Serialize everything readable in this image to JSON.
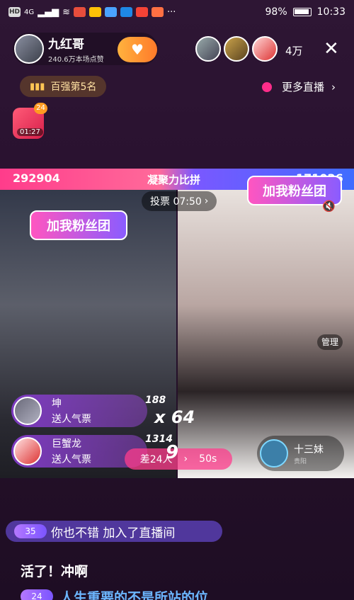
{
  "status": {
    "left_icons": [
      "HD",
      "4G",
      "signal-icon",
      "wifi-icon",
      "app-icon",
      "app-icon",
      "app-icon",
      "app-icon",
      "app-icon",
      "weibo-icon"
    ],
    "more": "···",
    "battery": "98%",
    "time": "10:33"
  },
  "host": {
    "name": "九红哥",
    "likes": "240.6万本场点赞",
    "follow_icon": "heart-plus-icon"
  },
  "viewers": {
    "count": "4万"
  },
  "rank": {
    "label": "百强第5名"
  },
  "more_live": {
    "label": "更多直播",
    "chevron": "›"
  },
  "gift_box": {
    "badge": "24",
    "timer": "01:27"
  },
  "pk": {
    "score_left": "292904",
    "title": "凝聚力比拼",
    "score_right": "171026",
    "vote": "投票 07:50",
    "vote_chevron": "›",
    "diff_label": "差24人",
    "diff_chevron": "›",
    "diff_time": "50s",
    "multiplier_overlay": "9"
  },
  "fan_badge": {
    "left": "加我粉丝团",
    "right": "加我粉丝团"
  },
  "manage_label": "管理",
  "gift_messages": [
    {
      "name": "坤",
      "action": "送人气票",
      "count": "188",
      "combo": "x 64"
    },
    {
      "name": "巨蟹龙",
      "action": "送人气票",
      "count": "1314",
      "combo": "x"
    }
  ],
  "opponent": {
    "name": "十三妹",
    "location": "贵阳"
  },
  "chat": {
    "join_level": "35",
    "join_text": "你也不错 加入了直播间",
    "message1": "活了！冲啊",
    "level2": "24",
    "message2": "人生重要的不是所站的位"
  },
  "colors": {
    "pk_left": "#ff3c8b",
    "pk_right": "#3f6cff",
    "follow": "#ff9b2e",
    "link_blue": "#6cb6ff"
  }
}
